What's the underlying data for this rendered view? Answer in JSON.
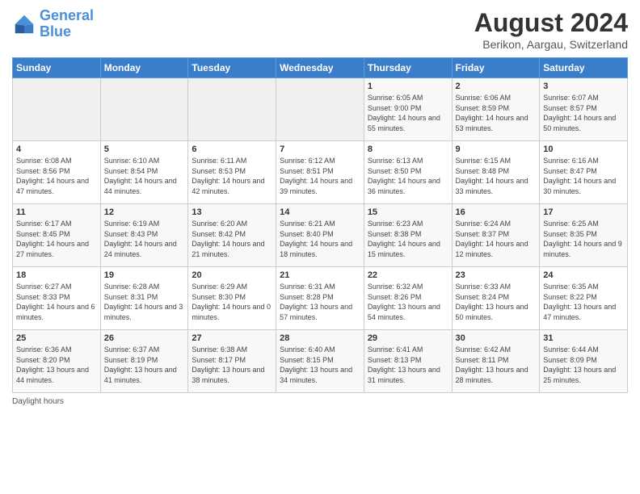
{
  "header": {
    "logo_general": "General",
    "logo_blue": "Blue",
    "month_title": "August 2024",
    "location": "Berikon, Aargau, Switzerland"
  },
  "days_of_week": [
    "Sunday",
    "Monday",
    "Tuesday",
    "Wednesday",
    "Thursday",
    "Friday",
    "Saturday"
  ],
  "weeks": [
    [
      {
        "day": "",
        "sunrise": "",
        "sunset": "",
        "daylight": ""
      },
      {
        "day": "",
        "sunrise": "",
        "sunset": "",
        "daylight": ""
      },
      {
        "day": "",
        "sunrise": "",
        "sunset": "",
        "daylight": ""
      },
      {
        "day": "",
        "sunrise": "",
        "sunset": "",
        "daylight": ""
      },
      {
        "day": "1",
        "sunrise": "Sunrise: 6:05 AM",
        "sunset": "Sunset: 9:00 PM",
        "daylight": "Daylight: 14 hours and 55 minutes."
      },
      {
        "day": "2",
        "sunrise": "Sunrise: 6:06 AM",
        "sunset": "Sunset: 8:59 PM",
        "daylight": "Daylight: 14 hours and 53 minutes."
      },
      {
        "day": "3",
        "sunrise": "Sunrise: 6:07 AM",
        "sunset": "Sunset: 8:57 PM",
        "daylight": "Daylight: 14 hours and 50 minutes."
      }
    ],
    [
      {
        "day": "4",
        "sunrise": "Sunrise: 6:08 AM",
        "sunset": "Sunset: 8:56 PM",
        "daylight": "Daylight: 14 hours and 47 minutes."
      },
      {
        "day": "5",
        "sunrise": "Sunrise: 6:10 AM",
        "sunset": "Sunset: 8:54 PM",
        "daylight": "Daylight: 14 hours and 44 minutes."
      },
      {
        "day": "6",
        "sunrise": "Sunrise: 6:11 AM",
        "sunset": "Sunset: 8:53 PM",
        "daylight": "Daylight: 14 hours and 42 minutes."
      },
      {
        "day": "7",
        "sunrise": "Sunrise: 6:12 AM",
        "sunset": "Sunset: 8:51 PM",
        "daylight": "Daylight: 14 hours and 39 minutes."
      },
      {
        "day": "8",
        "sunrise": "Sunrise: 6:13 AM",
        "sunset": "Sunset: 8:50 PM",
        "daylight": "Daylight: 14 hours and 36 minutes."
      },
      {
        "day": "9",
        "sunrise": "Sunrise: 6:15 AM",
        "sunset": "Sunset: 8:48 PM",
        "daylight": "Daylight: 14 hours and 33 minutes."
      },
      {
        "day": "10",
        "sunrise": "Sunrise: 6:16 AM",
        "sunset": "Sunset: 8:47 PM",
        "daylight": "Daylight: 14 hours and 30 minutes."
      }
    ],
    [
      {
        "day": "11",
        "sunrise": "Sunrise: 6:17 AM",
        "sunset": "Sunset: 8:45 PM",
        "daylight": "Daylight: 14 hours and 27 minutes."
      },
      {
        "day": "12",
        "sunrise": "Sunrise: 6:19 AM",
        "sunset": "Sunset: 8:43 PM",
        "daylight": "Daylight: 14 hours and 24 minutes."
      },
      {
        "day": "13",
        "sunrise": "Sunrise: 6:20 AM",
        "sunset": "Sunset: 8:42 PM",
        "daylight": "Daylight: 14 hours and 21 minutes."
      },
      {
        "day": "14",
        "sunrise": "Sunrise: 6:21 AM",
        "sunset": "Sunset: 8:40 PM",
        "daylight": "Daylight: 14 hours and 18 minutes."
      },
      {
        "day": "15",
        "sunrise": "Sunrise: 6:23 AM",
        "sunset": "Sunset: 8:38 PM",
        "daylight": "Daylight: 14 hours and 15 minutes."
      },
      {
        "day": "16",
        "sunrise": "Sunrise: 6:24 AM",
        "sunset": "Sunset: 8:37 PM",
        "daylight": "Daylight: 14 hours and 12 minutes."
      },
      {
        "day": "17",
        "sunrise": "Sunrise: 6:25 AM",
        "sunset": "Sunset: 8:35 PM",
        "daylight": "Daylight: 14 hours and 9 minutes."
      }
    ],
    [
      {
        "day": "18",
        "sunrise": "Sunrise: 6:27 AM",
        "sunset": "Sunset: 8:33 PM",
        "daylight": "Daylight: 14 hours and 6 minutes."
      },
      {
        "day": "19",
        "sunrise": "Sunrise: 6:28 AM",
        "sunset": "Sunset: 8:31 PM",
        "daylight": "Daylight: 14 hours and 3 minutes."
      },
      {
        "day": "20",
        "sunrise": "Sunrise: 6:29 AM",
        "sunset": "Sunset: 8:30 PM",
        "daylight": "Daylight: 14 hours and 0 minutes."
      },
      {
        "day": "21",
        "sunrise": "Sunrise: 6:31 AM",
        "sunset": "Sunset: 8:28 PM",
        "daylight": "Daylight: 13 hours and 57 minutes."
      },
      {
        "day": "22",
        "sunrise": "Sunrise: 6:32 AM",
        "sunset": "Sunset: 8:26 PM",
        "daylight": "Daylight: 13 hours and 54 minutes."
      },
      {
        "day": "23",
        "sunrise": "Sunrise: 6:33 AM",
        "sunset": "Sunset: 8:24 PM",
        "daylight": "Daylight: 13 hours and 50 minutes."
      },
      {
        "day": "24",
        "sunrise": "Sunrise: 6:35 AM",
        "sunset": "Sunset: 8:22 PM",
        "daylight": "Daylight: 13 hours and 47 minutes."
      }
    ],
    [
      {
        "day": "25",
        "sunrise": "Sunrise: 6:36 AM",
        "sunset": "Sunset: 8:20 PM",
        "daylight": "Daylight: 13 hours and 44 minutes."
      },
      {
        "day": "26",
        "sunrise": "Sunrise: 6:37 AM",
        "sunset": "Sunset: 8:19 PM",
        "daylight": "Daylight: 13 hours and 41 minutes."
      },
      {
        "day": "27",
        "sunrise": "Sunrise: 6:38 AM",
        "sunset": "Sunset: 8:17 PM",
        "daylight": "Daylight: 13 hours and 38 minutes."
      },
      {
        "day": "28",
        "sunrise": "Sunrise: 6:40 AM",
        "sunset": "Sunset: 8:15 PM",
        "daylight": "Daylight: 13 hours and 34 minutes."
      },
      {
        "day": "29",
        "sunrise": "Sunrise: 6:41 AM",
        "sunset": "Sunset: 8:13 PM",
        "daylight": "Daylight: 13 hours and 31 minutes."
      },
      {
        "day": "30",
        "sunrise": "Sunrise: 6:42 AM",
        "sunset": "Sunset: 8:11 PM",
        "daylight": "Daylight: 13 hours and 28 minutes."
      },
      {
        "day": "31",
        "sunrise": "Sunrise: 6:44 AM",
        "sunset": "Sunset: 8:09 PM",
        "daylight": "Daylight: 13 hours and 25 minutes."
      }
    ]
  ],
  "footer": {
    "daylight_label": "Daylight hours"
  }
}
